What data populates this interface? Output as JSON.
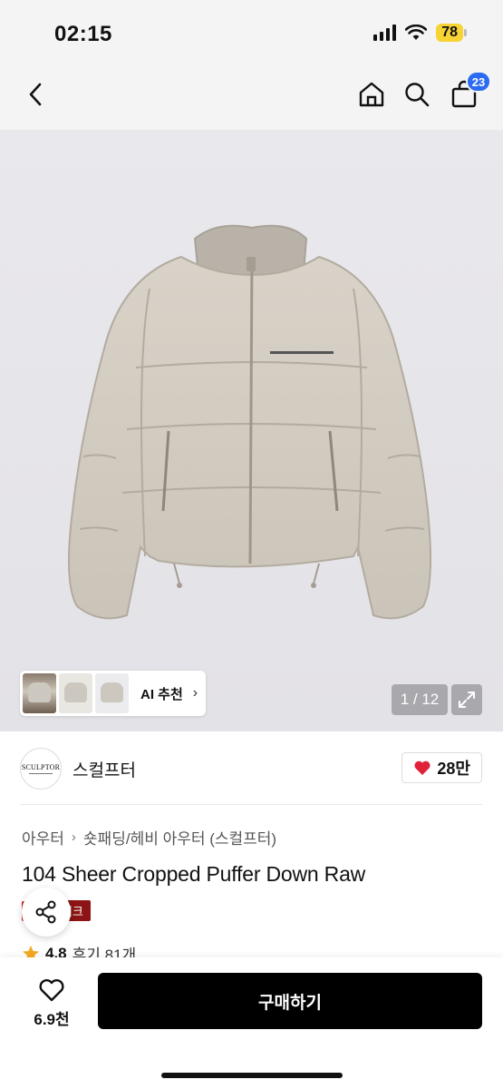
{
  "status_bar": {
    "time": "02:15",
    "battery": "78"
  },
  "nav": {
    "cart_badge": "23"
  },
  "gallery": {
    "ai_label": "AI 추천",
    "page_counter": "1 / 12"
  },
  "brand": {
    "logo_text": "SCULPTOR",
    "name": "스컬프터",
    "likes": "28만"
  },
  "breadcrumb": {
    "level1": "아우터",
    "level2": "숏패딩/헤비 아우터 (스컬프터)"
  },
  "product": {
    "title": "104 Sheer Cropped Puffer Down Raw",
    "tag": "스위크",
    "rating": "4.8",
    "reviews": "후기 81개"
  },
  "bottom": {
    "wish_count": "6.9천",
    "buy_label": "구매하기"
  },
  "colors": {
    "accent_blue": "#2b6bf3",
    "heart_red": "#e0223a",
    "tag_red": "#8c1414",
    "battery_yellow": "#f7d434"
  }
}
